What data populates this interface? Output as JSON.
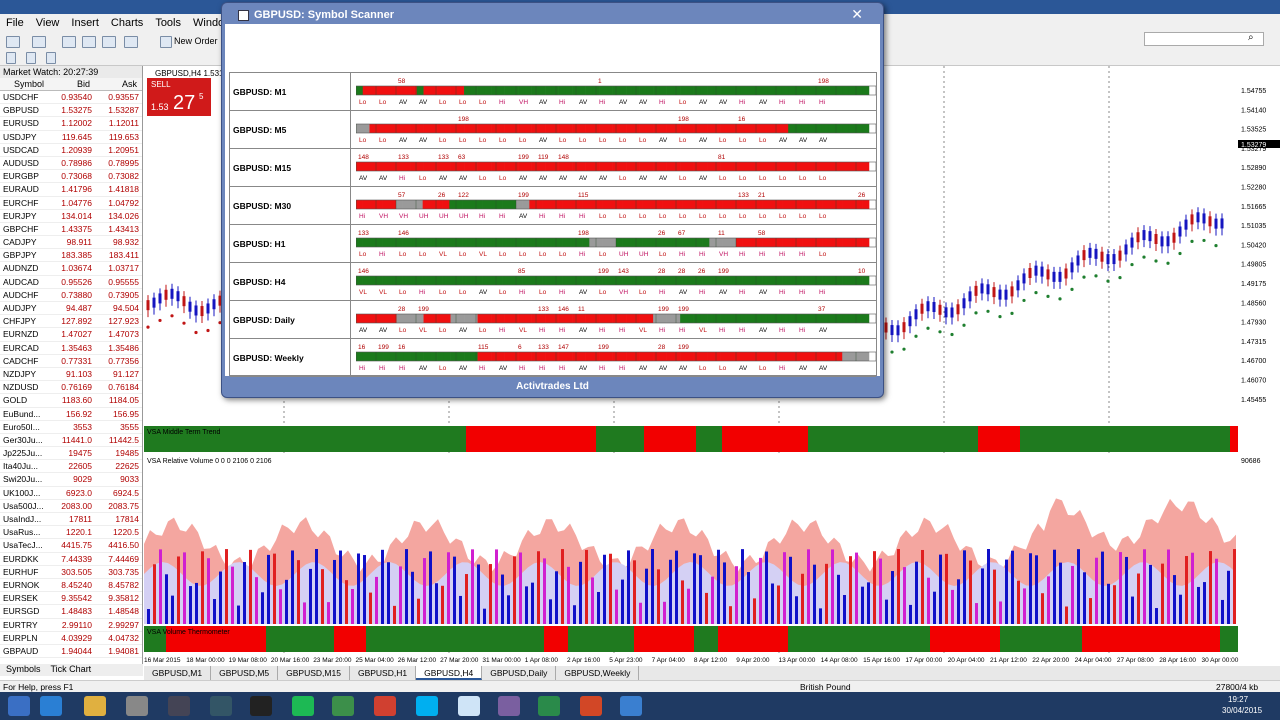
{
  "window": {
    "menu": [
      "File",
      "View",
      "Insert",
      "Charts",
      "Tools",
      "Window",
      "Help"
    ],
    "new_order": "New Order"
  },
  "market_watch": {
    "title": "Market Watch: 20:27:39",
    "headers": [
      "Symbol",
      "Bid",
      "Ask"
    ],
    "rows": [
      [
        "USDCHF",
        "0.93540",
        "0.93557"
      ],
      [
        "GBPUSD",
        "1.53275",
        "1.53287"
      ],
      [
        "EURUSD",
        "1.12002",
        "1.12011"
      ],
      [
        "USDJPY",
        "119.645",
        "119.653"
      ],
      [
        "USDCAD",
        "1.20939",
        "1.20951"
      ],
      [
        "AUDUSD",
        "0.78986",
        "0.78995"
      ],
      [
        "EURGBP",
        "0.73068",
        "0.73082"
      ],
      [
        "EURAUD",
        "1.41796",
        "1.41818"
      ],
      [
        "EURCHF",
        "1.04776",
        "1.04792"
      ],
      [
        "EURJPY",
        "134.014",
        "134.026"
      ],
      [
        "GBPCHF",
        "1.43375",
        "1.43413"
      ],
      [
        "CADJPY",
        "98.911",
        "98.932"
      ],
      [
        "GBPJPY",
        "183.385",
        "183.411"
      ],
      [
        "AUDNZD",
        "1.03674",
        "1.03717"
      ],
      [
        "AUDCAD",
        "0.95526",
        "0.95555"
      ],
      [
        "AUDCHF",
        "0.73880",
        "0.73905"
      ],
      [
        "AUDJPY",
        "94.487",
        "94.504"
      ],
      [
        "CHFJPY",
        "127.892",
        "127.923"
      ],
      [
        "EURNZD",
        "1.47027",
        "1.47073"
      ],
      [
        "EURCAD",
        "1.35463",
        "1.35486"
      ],
      [
        "CADCHF",
        "0.77331",
        "0.77356"
      ],
      [
        "NZDJPY",
        "91.103",
        "91.127"
      ],
      [
        "NZDUSD",
        "0.76169",
        "0.76184"
      ],
      [
        "GOLD",
        "1183.60",
        "1184.05"
      ],
      [
        "EuBund...",
        "156.92",
        "156.95"
      ],
      [
        "Euro50I...",
        "3553",
        "3555"
      ],
      [
        "Ger30Ju...",
        "11441.0",
        "11442.5"
      ],
      [
        "Jp225Ju...",
        "19475",
        "19485"
      ],
      [
        "Ita40Ju...",
        "22605",
        "22625"
      ],
      [
        "Swi20Ju...",
        "9029",
        "9033"
      ],
      [
        "UK100J...",
        "6923.0",
        "6924.5"
      ],
      [
        "Usa500J...",
        "2083.00",
        "2083.75"
      ],
      [
        "UsaIndJ...",
        "17811",
        "17814"
      ],
      [
        "UsaRus...",
        "1220.1",
        "1220.5"
      ],
      [
        "UsaTecJ...",
        "4415.75",
        "4416.50"
      ],
      [
        "EURDKK",
        "7.44339",
        "7.44469"
      ],
      [
        "EURHUF",
        "303.505",
        "303.735"
      ],
      [
        "EURNOK",
        "8.45240",
        "8.45782"
      ],
      [
        "EURSEK",
        "9.35542",
        "9.35812"
      ],
      [
        "EURSGD",
        "1.48483",
        "1.48548"
      ],
      [
        "EURTRY",
        "2.99110",
        "2.99297"
      ],
      [
        "EURPLN",
        "4.03929",
        "4.04732"
      ],
      [
        "GBPAUD",
        "1.94044",
        "1.94081"
      ]
    ],
    "tabs": [
      "Symbols",
      "Tick Chart"
    ]
  },
  "chart": {
    "header": "GBPUSD,H4 1.53158",
    "sell_label": "SELL",
    "sell_price_small": "1.53",
    "sell_price_big": "27",
    "sell_price_sup": "5",
    "ind1_label": "VSA Middle Term Trend",
    "ind2_label": "VSA Relative Volume 0 0 0 2106 0 2106",
    "ind3_label": "VSA Volume Thermometer",
    "max_vol": "90686",
    "prices": [
      "1.54755",
      "1.54140",
      "1.53525",
      "1.53279",
      "1.52890",
      "1.52280",
      "1.51665",
      "1.51035",
      "1.50420",
      "1.49805",
      "1.49175",
      "1.48560",
      "1.47930",
      "1.47315",
      "1.46700",
      "1.46070",
      "1.45455"
    ],
    "dates": [
      "16 Mar 2015",
      "18 Mar 00:00",
      "19 Mar 08:00",
      "20 Mar 16:00",
      "23 Mar 20:00",
      "25 Mar 04:00",
      "26 Mar 12:00",
      "27 Mar 20:00",
      "31 Mar 00:00",
      "1 Apr 08:00",
      "2 Apr 16:00",
      "5 Apr 23:00",
      "7 Apr 04:00",
      "8 Apr 12:00",
      "9 Apr 20:00",
      "13 Apr 00:00",
      "14 Apr 08:00",
      "15 Apr 16:00",
      "17 Apr 00:00",
      "20 Apr 04:00",
      "21 Apr 12:00",
      "22 Apr 20:00",
      "24 Apr 04:00",
      "27 Apr 08:00",
      "28 Apr 16:00",
      "30 Apr 00:00"
    ],
    "tabs": [
      "GBPUSD,M1",
      "GBPUSD,M5",
      "GBPUSD,M15",
      "GBPUSD,H1",
      "GBPUSD,H4",
      "GBPUSD,Daily",
      "GBPUSD,Weekly"
    ],
    "active_tab": "GBPUSD,H4"
  },
  "scanner": {
    "title": "GBPUSD: Symbol Scanner",
    "footer": "Activtrades Ltd",
    "rows": [
      {
        "label": "GBPUSD: M1",
        "colors": "gRRRRRRRRGRRRRRRGGGGGGGGGGGGGGGGGGGGGGGGGGGGGGGGGGGGGGGGGGGGGGGGGGGGGGGGGGGGW",
        "nums": [
          [
            "58",
            2
          ],
          [
            "1",
            12
          ],
          [
            "198",
            23
          ],
          [
            "11",
            30
          ],
          [
            "198",
            32
          ]
        ],
        "codes": [
          "Lo",
          "Lo",
          "AV",
          "AV",
          "Lo",
          "Lo",
          "Lo",
          "Hi",
          "VH",
          "AV",
          "Hi",
          "AV",
          "Hi",
          "AV",
          "AV",
          "Hi",
          "Lo",
          "AV",
          "AV",
          "Hi",
          "AV",
          "Hi",
          "Hi",
          "Hi"
        ]
      },
      {
        "label": "GBPUSD: M5",
        "colors": "NNRRRRRRRRRRRRRRRRRRRRRRRRRRRRRRRRRRRRRRRRRRRRRRRRRRRRRRRRRRRRRRGGGGGGGGGGGGW",
        "nums": [
          [
            "198",
            5
          ],
          [
            "198",
            16
          ],
          [
            "16",
            19
          ],
          [
            "198",
            26
          ]
        ],
        "codes": [
          "Lo",
          "Lo",
          "AV",
          "AV",
          "Lo",
          "Lo",
          "Lo",
          "Lo",
          "Lo",
          "AV",
          "Lo",
          "Lo",
          "Lo",
          "Lo",
          "Lo",
          "AV",
          "Lo",
          "AV",
          "Lo",
          "Lo",
          "Lo",
          "AV",
          "AV",
          "AV"
        ]
      },
      {
        "label": "GBPUSD: M15",
        "colors": "RRRRRRRRRRRRRRRRRRRRRRRRRRRRRRRRRRRRRRRRRRRRRRRRRRRRRRRRRRRRRRRRRRRRRRRRRRRRW",
        "nums": [
          [
            "148",
            0
          ],
          [
            "133",
            2
          ],
          [
            "133",
            4
          ],
          [
            "63",
            5
          ],
          [
            "199",
            8
          ],
          [
            "119",
            9
          ],
          [
            "148",
            10
          ],
          [
            "81",
            18
          ],
          [
            "198",
            26
          ]
        ],
        "codes": [
          "AV",
          "AV",
          "Hi",
          "Lo",
          "AV",
          "AV",
          "Lo",
          "Lo",
          "AV",
          "AV",
          "AV",
          "AV",
          "AV",
          "Lo",
          "AV",
          "AV",
          "Lo",
          "AV",
          "Lo",
          "Lo",
          "Lo",
          "Lo",
          "Lo",
          "Lo"
        ]
      },
      {
        "label": "GBPUSD: M30",
        "colors": "RRRRRRNNNNRRRRGGGGGGGGGGNNRRRRRRRRRRRRRRRRRRRRRRRRRRRRRRRRRRRRRRRRRRRRRRRRRRRW",
        "nums": [
          [
            "57",
            2
          ],
          [
            "26",
            4
          ],
          [
            "122",
            5
          ],
          [
            "199",
            8
          ],
          [
            "115",
            11
          ],
          [
            "133",
            19
          ],
          [
            "21",
            20
          ],
          [
            "26",
            25
          ],
          [
            "146",
            26
          ],
          [
            "199",
            27
          ]
        ],
        "codes": [
          "Hi",
          "VH",
          "VH",
          "UH",
          "UH",
          "UH",
          "Hi",
          "Hi",
          "AV",
          "Hi",
          "Hi",
          "Hi",
          "Lo",
          "Lo",
          "Lo",
          "Lo",
          "Lo",
          "Lo",
          "Lo",
          "Lo",
          "Lo",
          "Lo",
          "Lo",
          "Lo"
        ]
      },
      {
        "label": "GBPUSD: H1",
        "colors": "GGGGGGGGGGGGGGGGGGGGGGGGGGGGGGGGGGGNNNNGGGGGGGGGGGGGGNNNNRRRRRRRRRRRRRRRRRRRRW",
        "nums": [
          [
            "133",
            0
          ],
          [
            "146",
            2
          ],
          [
            "198",
            11
          ],
          [
            "26",
            15
          ],
          [
            "67",
            16
          ],
          [
            "11",
            18
          ],
          [
            "58",
            20
          ]
        ],
        "codes": [
          "Lo",
          "Hi",
          "Lo",
          "Lo",
          "VL",
          "Lo",
          "VL",
          "Lo",
          "Lo",
          "Lo",
          "Lo",
          "Hi",
          "Lo",
          "UH",
          "UH",
          "Lo",
          "Hi",
          "Hi",
          "VH",
          "Hi",
          "Hi",
          "Hi",
          "Hi",
          "Lo"
        ]
      },
      {
        "label": "GBPUSD: H4",
        "colors": "GGGGGGGGGGGGGGGGGGGGGGGGGGGGGGGGGGGGGGGGGGGGGGGGGGGGGGGGGGGGGGGGGGGGGGGGGGGGGW",
        "nums": [
          [
            "146",
            0
          ],
          [
            "85",
            8
          ],
          [
            "199",
            12
          ],
          [
            "143",
            13
          ],
          [
            "28",
            15
          ],
          [
            "28",
            16
          ],
          [
            "26",
            17
          ],
          [
            "199",
            18
          ],
          [
            "10",
            25
          ],
          [
            "199",
            27
          ]
        ],
        "codes": [
          "VL",
          "VL",
          "Lo",
          "Hi",
          "Lo",
          "Lo",
          "AV",
          "Lo",
          "Hi",
          "Lo",
          "Hi",
          "AV",
          "Lo",
          "VH",
          "Lo",
          "Hi",
          "AV",
          "Hi",
          "AV",
          "Hi",
          "AV",
          "Hi",
          "Hi",
          "Hi"
        ]
      },
      {
        "label": "GBPUSD: Daily",
        "colors": "RRRRRRNNNNRRRRNNNNRRRRRRRRRRRRRRRRRRRRRRRRRRNNNNGGGGGGGGGGGGGGGGGGGGGGGGGGGGW",
        "nums": [
          [
            "28",
            2
          ],
          [
            "199",
            3
          ],
          [
            "133",
            9
          ],
          [
            "146",
            10
          ],
          [
            "11",
            11
          ],
          [
            "199",
            15
          ],
          [
            "199",
            16
          ],
          [
            "37",
            23
          ]
        ],
        "codes": [
          "AV",
          "AV",
          "Lo",
          "VL",
          "Lo",
          "AV",
          "Lo",
          "Hi",
          "VL",
          "Hi",
          "Hi",
          "AV",
          "Hi",
          "Hi",
          "VL",
          "Hi",
          "Hi",
          "VL",
          "Hi",
          "Hi",
          "AV",
          "Hi",
          "Hi",
          "AV"
        ]
      },
      {
        "label": "GBPUSD: Weekly",
        "colors": "GGGGGGGGGGGGGGGGGGRRRRRRRRRRRRRRRRRRRRRRRRRRRRRRRRRRRRRRRRRRRRRRRRRRRRRRNNNNW",
        "nums": [
          [
            "16",
            0
          ],
          [
            "199",
            1
          ],
          [
            "16",
            2
          ],
          [
            "115",
            6
          ],
          [
            "6",
            8
          ],
          [
            "133",
            9
          ],
          [
            "147",
            10
          ],
          [
            "199",
            12
          ],
          [
            "28",
            15
          ],
          [
            "199",
            16
          ]
        ],
        "codes": [
          "Hi",
          "Hi",
          "Hi",
          "AV",
          "Lo",
          "AV",
          "Hi",
          "AV",
          "Hi",
          "Hi",
          "Hi",
          "AV",
          "Hi",
          "Hi",
          "AV",
          "AV",
          "AV",
          "Lo",
          "Lo",
          "AV",
          "Lo",
          "Hi",
          "AV",
          "AV"
        ]
      }
    ]
  },
  "status": {
    "help": "For Help, press F1",
    "profile": "British Pound",
    "traffic": "27800/4 kb"
  },
  "taskbar": {
    "time": "19:27",
    "date": "30/04/2015"
  }
}
